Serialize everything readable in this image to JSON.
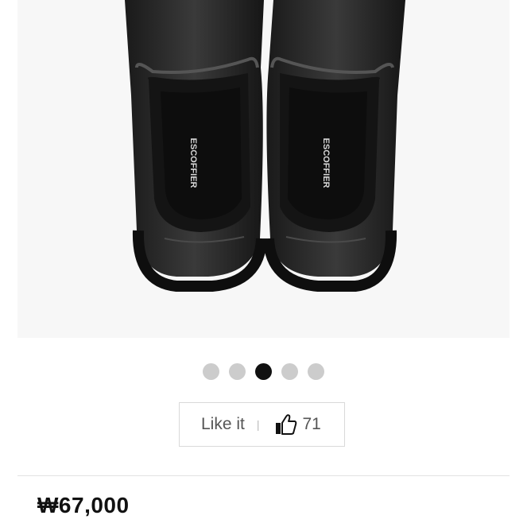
{
  "product": {
    "image_alt": "black slip-on shoes",
    "insole_brand": "ESCOFFIER"
  },
  "carousel": {
    "total": 5,
    "active_index": 2
  },
  "like": {
    "label": "Like it",
    "separator": "|",
    "count": "71",
    "icon": "thumbs-up-icon"
  },
  "price": {
    "text": "₩67,000"
  },
  "colors": {
    "dot_inactive": "#cccccc",
    "dot_active": "#111111",
    "price_text": "#111111"
  }
}
